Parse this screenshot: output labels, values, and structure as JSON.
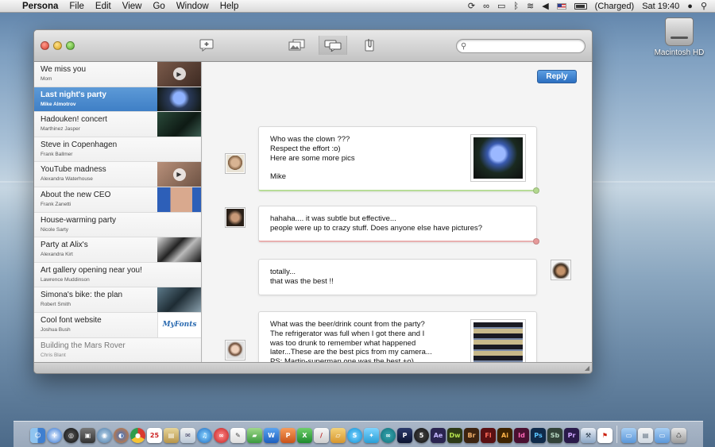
{
  "menubar": {
    "app_name": "Persona",
    "menus": [
      "File",
      "Edit",
      "View",
      "Go",
      "Window",
      "Help"
    ],
    "battery_label": "(Charged)",
    "clock": "Sat 19:40"
  },
  "desktop": {
    "hd_label": "Macintosh HD"
  },
  "toolbar": {
    "search_placeholder": "",
    "icons": [
      "compose-icon",
      "photos-icon",
      "conversation-icon",
      "attachment-icon"
    ]
  },
  "conversations": [
    {
      "subject": "We miss you",
      "from": "Mom",
      "thumb": "video"
    },
    {
      "subject": "Last night's party",
      "from": "Mike Almotrov",
      "thumb": "photo",
      "selected": true
    },
    {
      "subject": "Hadouken! concert",
      "from": "Marthinez Jasper",
      "thumb": "photo"
    },
    {
      "subject": "Steve in Copenhagen",
      "from": "Frank Ballmer",
      "thumb": "none"
    },
    {
      "subject": "YouTube madness",
      "from": "Alexandra Waterhouse",
      "thumb": "video"
    },
    {
      "subject": "About the new CEO",
      "from": "Frank Zanetti",
      "thumb": "photo"
    },
    {
      "subject": "House-warming party",
      "from": "Nicole Sarty",
      "thumb": "none"
    },
    {
      "subject": "Party at Alix's",
      "from": "Alexandra Kirt",
      "thumb": "photo"
    },
    {
      "subject": "Art gallery opening near you!",
      "from": "Lawrence Muddinson",
      "thumb": "none"
    },
    {
      "subject": "Simona's bike: the plan",
      "from": "Robert Smith",
      "thumb": "photo"
    },
    {
      "subject": "Cool font website",
      "from": "Joshua Bush",
      "thumb": "web",
      "thumb_text": "MyFonts"
    },
    {
      "subject": "Building the Mars Rover",
      "from": "Chris Blant",
      "thumb": "none"
    }
  ],
  "thread": {
    "reply_label": "Reply",
    "messages": [
      {
        "side": "left",
        "lines": [
          "Who was the clown ???",
          "Respect the effort :o)",
          "Here are some more pics",
          "",
          "Mike"
        ],
        "has_photo": true,
        "status": "green"
      },
      {
        "side": "left",
        "lines": [
          "hahaha.... it was subtle but effective...",
          "people were up to crazy stuff. Does anyone else have pictures?"
        ],
        "has_photo": false,
        "status": "red"
      },
      {
        "side": "right",
        "lines": [
          "totally...",
          "that was the best !!"
        ],
        "has_photo": false,
        "status": "none"
      },
      {
        "side": "left",
        "lines": [
          "What was the beer/drink count from the party?",
          "The refrigerator was full when I got there and I",
          "was too drunk to remember what happened",
          "later...These are the best pics from my camera...",
          "PS: Martin-superman one was the best +o)"
        ],
        "has_photo": true,
        "status": "green"
      }
    ]
  },
  "dock": {
    "apps": [
      "Finder",
      "Safari",
      "Dashboard",
      "Photo Booth",
      "Network",
      "Firefox",
      "Chrome",
      "iCal",
      "Preview",
      "Mail",
      "iTunes",
      "Persona",
      "Notes",
      "Messages",
      "Word",
      "PowerPoint",
      "Excel",
      "TextEdit",
      "Pages",
      "Skype",
      "Twitter",
      "Arduino",
      "Pandora",
      "5",
      "Ae",
      "Dw",
      "Br",
      "Fl",
      "Ai",
      "Id",
      "Ps",
      "Sb",
      "Pr",
      "Xcode",
      "Acrobat",
      "Applications",
      "Documents",
      "Downloads",
      "Trash"
    ]
  },
  "colors": {
    "selected_row": "#4a8bd0",
    "reply_button": "#3a7fd0",
    "status_green": "#b3d88f",
    "status_red": "#e69a9a"
  }
}
